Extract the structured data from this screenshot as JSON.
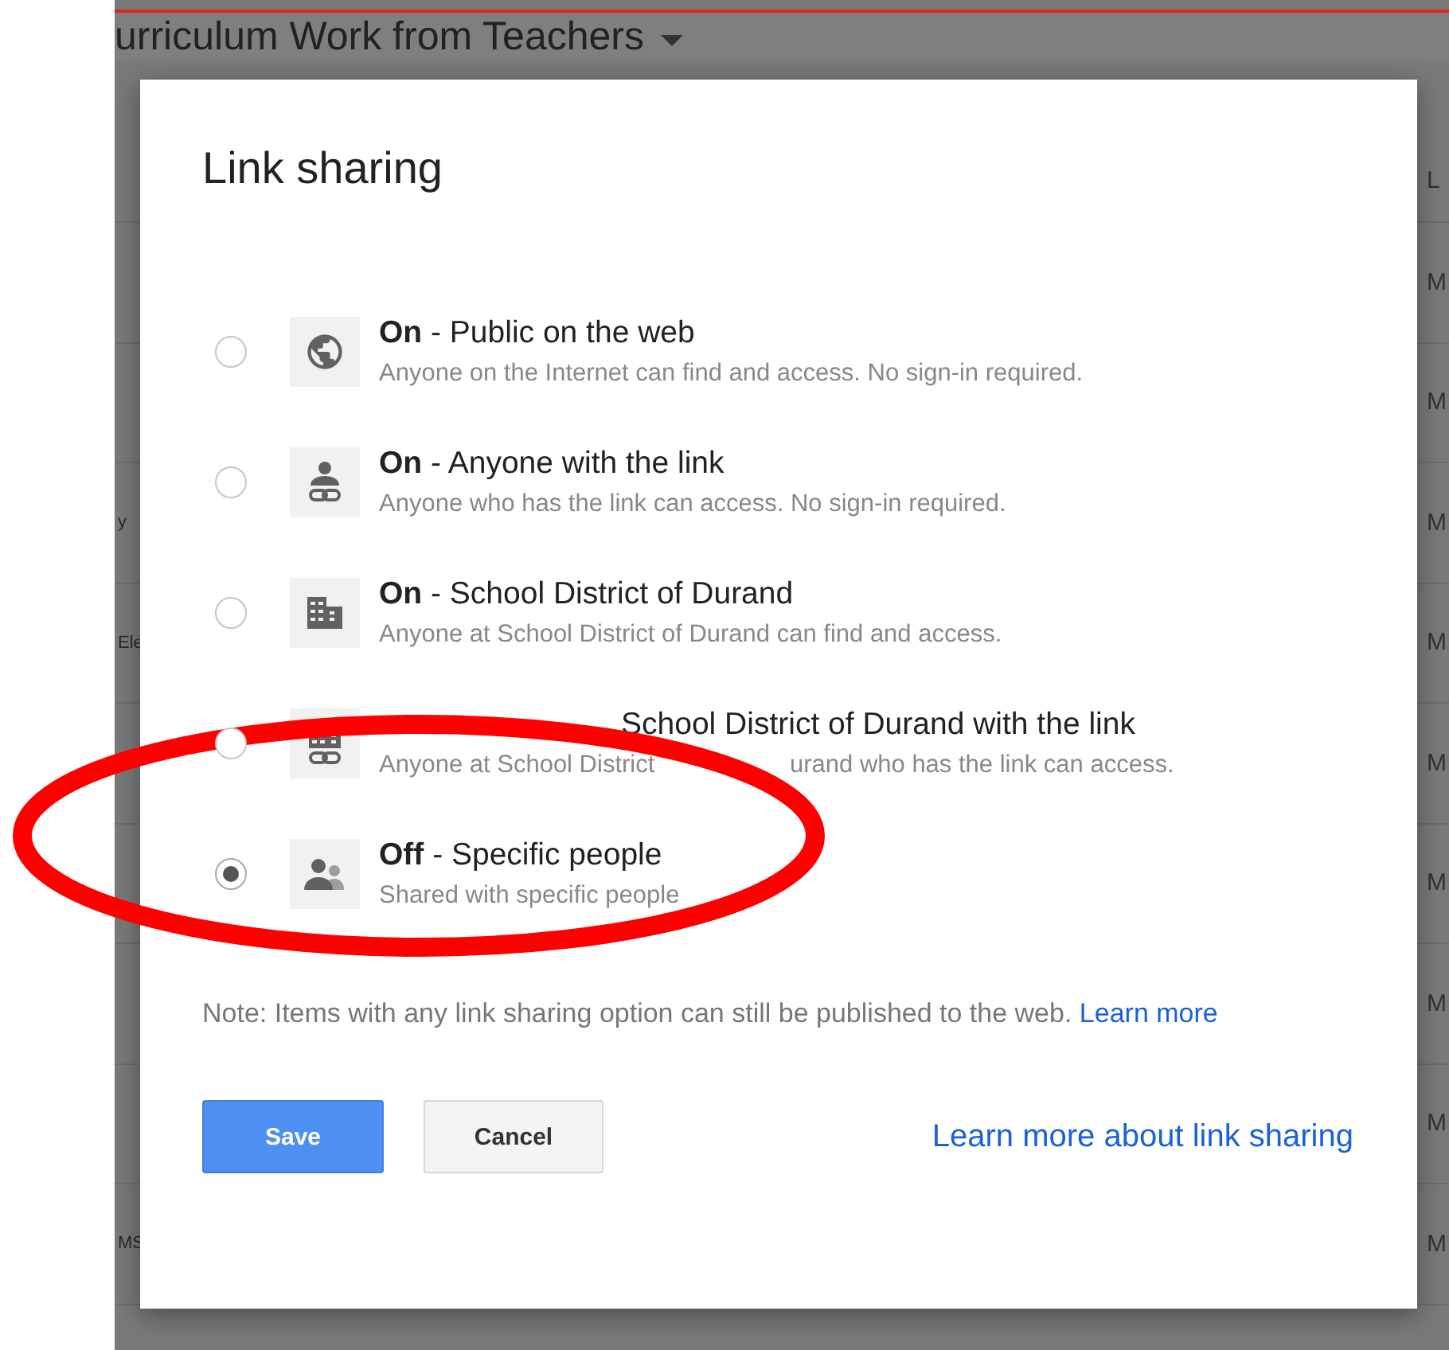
{
  "background": {
    "title": "urriculum Work from Teachers",
    "column_header": "L",
    "rows": [
      {
        "column_2": "M"
      },
      {
        "column_2": "M"
      },
      {
        "column_1": "y",
        "column_2": "M"
      },
      {
        "column_1": "Ele",
        "column_2": "M"
      },
      {
        "column_2": "M"
      },
      {
        "column_2": "M"
      },
      {
        "column_2": "M"
      },
      {
        "column_2": "M"
      },
      {
        "column_1": "MS",
        "column_2": "M"
      }
    ]
  },
  "dialog": {
    "title": "Link sharing",
    "options": [
      {
        "kind": "globe",
        "state": "On",
        "label": "- Public on the web",
        "description": "Anyone on the Internet can find and access. No sign-in required.",
        "selected": false
      },
      {
        "kind": "link",
        "state": "On",
        "label": "- Anyone with the link",
        "description": "Anyone who has the link can access. No sign-in required.",
        "selected": false
      },
      {
        "kind": "domain",
        "state": "On",
        "label": "- School District of Durand",
        "description": "Anyone at School District of Durand can find and access.",
        "selected": false
      },
      {
        "kind": "domainlink",
        "label": "School District of Durand with the link",
        "description_parts": [
          "Anyone at School District",
          "urand who has the link can access."
        ],
        "selected": false
      },
      {
        "kind": "people",
        "state": "Off",
        "label": "- Specific people",
        "description": "Shared with specific people",
        "selected": true
      }
    ],
    "note": "Note: Items with any link sharing option can still be published to the web.",
    "note_link": "Learn more",
    "save": "Save",
    "cancel": "Cancel",
    "help_link": "Learn more about link sharing"
  }
}
